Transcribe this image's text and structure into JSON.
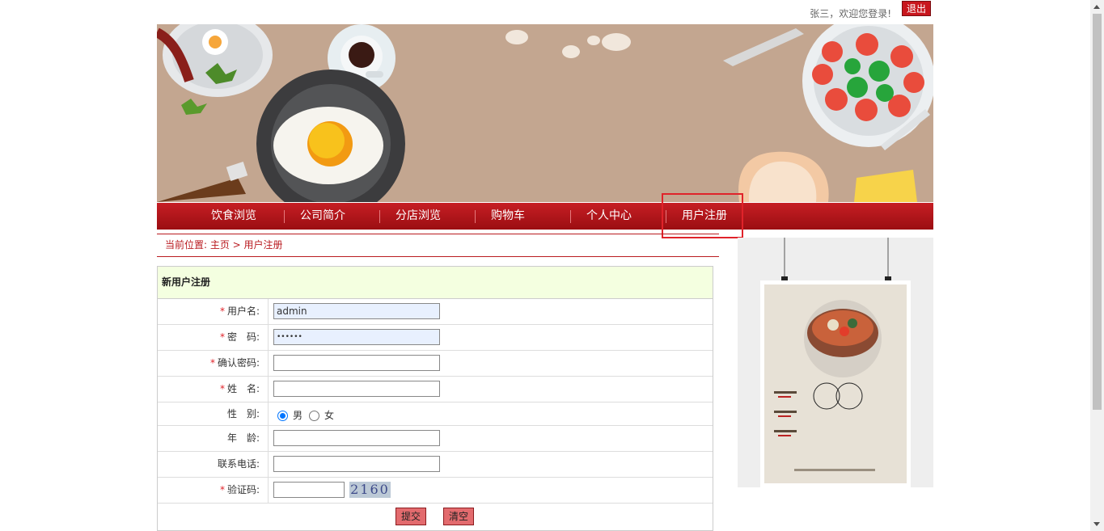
{
  "header": {
    "welcome_text": "张三，欢迎您登录!",
    "logout_label": "退出"
  },
  "nav": {
    "items": [
      {
        "label": "饮食浏览"
      },
      {
        "label": "公司简介"
      },
      {
        "label": "分店浏览"
      },
      {
        "label": "购物车"
      },
      {
        "label": "个人中心"
      },
      {
        "label": "用户注册"
      }
    ],
    "active_item": "用户注册"
  },
  "breadcrumb": {
    "text": "当前位置: 主页 > 用户注册"
  },
  "form": {
    "title": "新用户注册",
    "fields": {
      "username": {
        "label": "用户名:",
        "value": "admin",
        "required": true
      },
      "password": {
        "label": "密　码:",
        "value": "••••••",
        "required": true
      },
      "confirm_password": {
        "label": "确认密码:",
        "value": "",
        "required": true
      },
      "real_name": {
        "label": "姓　名:",
        "value": "",
        "required": true
      },
      "gender": {
        "label": "性　别:",
        "options": [
          "男",
          "女"
        ],
        "selected": "男"
      },
      "age": {
        "label": "年　龄:",
        "value": ""
      },
      "phone": {
        "label": "联系电话:",
        "value": ""
      },
      "captcha": {
        "label": "验证码:",
        "value": "",
        "required": true,
        "code": "2160"
      }
    },
    "required_mark": "*",
    "submit_label": "提交",
    "reset_label": "清空"
  },
  "colors": {
    "brand_red": "#c8161d",
    "form_header_bg": "#f4ffe0",
    "autofill_bg": "#e8f0fe"
  },
  "icons": {
    "banner": "food-banner-illustration",
    "poster": "seafood-hotpot-poster"
  }
}
